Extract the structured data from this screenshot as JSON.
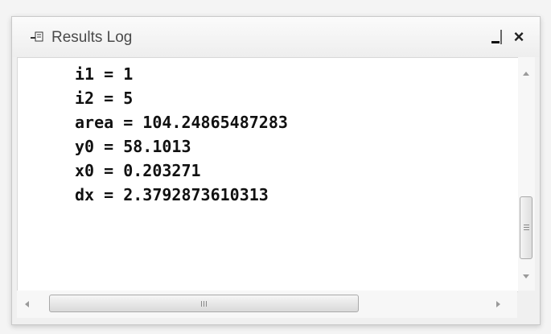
{
  "window": {
    "title": "Results Log"
  },
  "icons": {
    "app": "results-log-app-icon",
    "minimize": "minimize-icon",
    "close": "close-icon",
    "close_glyph": "×"
  },
  "log": {
    "lines": [
      "i1 = 1",
      "i2 = 5",
      "area = 104.24865487283",
      "y0 = 58.1013",
      "x0 = 0.203271",
      "dx = 2.3792873610313"
    ]
  },
  "colors": {
    "text": "#111111",
    "background": "#ffffff",
    "title_text": "#4a4a4a"
  }
}
